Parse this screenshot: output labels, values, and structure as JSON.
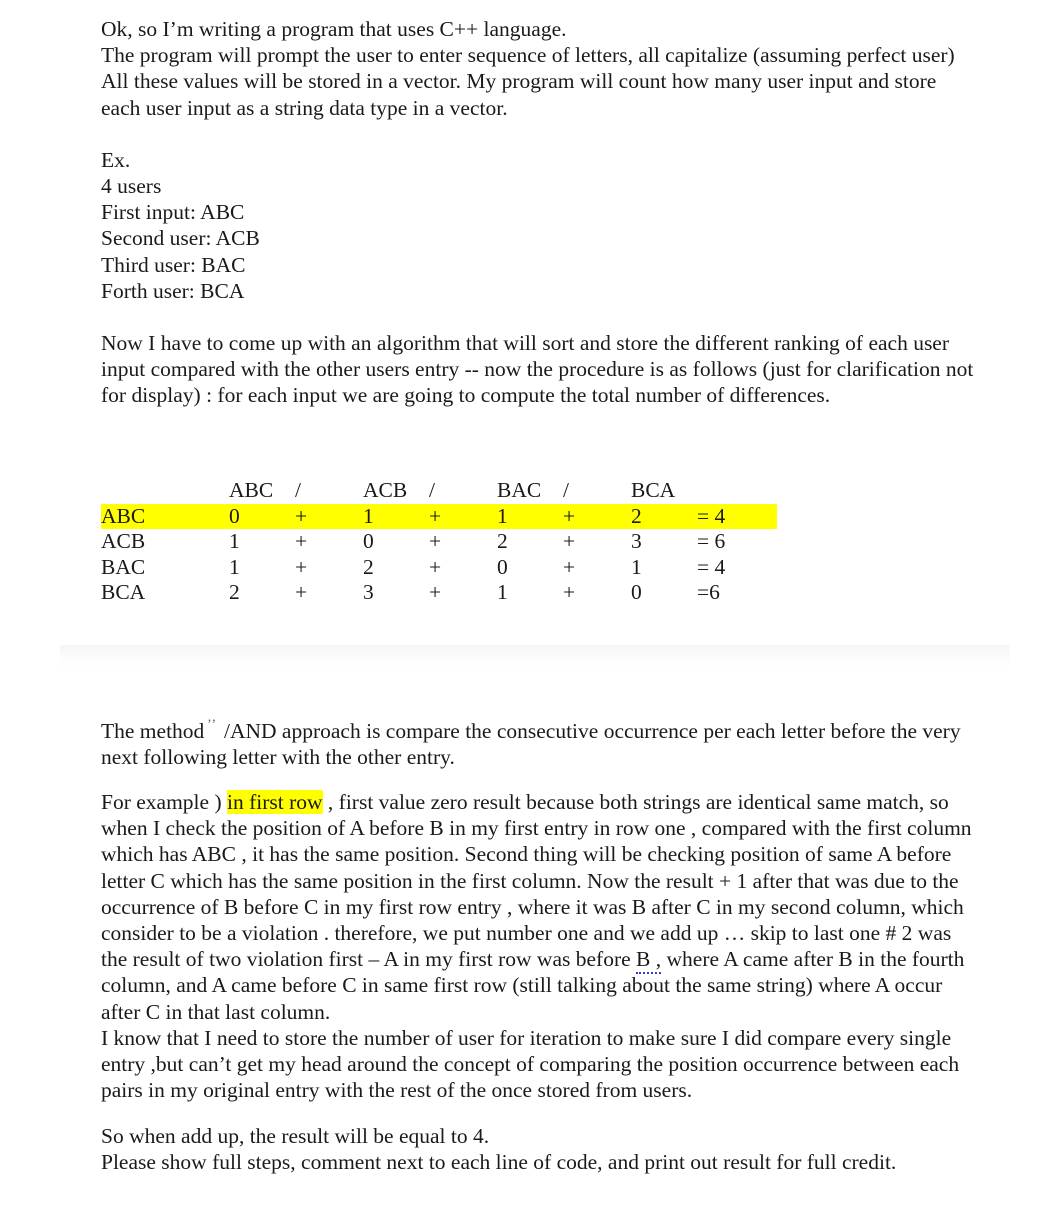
{
  "document": {
    "intro": {
      "line1": "Ok, so I’m writing a program that uses C++ language.",
      "line2": "The program will prompt the user to enter sequence of letters, all capitalize (assuming perfect user)",
      "line3": "All these values will be stored in a vector. My program will count how many user input and store each user input as a string data type in a vector."
    },
    "example": {
      "heading": "Ex.",
      "count": "4 users",
      "entries": [
        "First input: ABC",
        "Second user: ACB",
        "Third user: BAC",
        "Forth user: BCA"
      ]
    },
    "algorithm_paragraph": "Now I have to come up with an algorithm that will sort and store the different ranking of each user input compared with the other users entry -- now the procedure is as follows (just for clarification not for display) : for each input we are going to compute the total number of differences.",
    "method_paragraph": {
      "before_mark": "The method",
      "mark": "’’",
      "after_mark": "/AND approach is compare the consecutive occurrence per each letter before the very next following letter with the other entry."
    },
    "explanation_paragraph": {
      "lead": "For example ) ",
      "highlight": "in first row",
      "rest_a": " , first value zero result because both strings are identical same match, so when I check the position of A before B in my first entry in row one , compared with the first column which has ABC , it has the same position. Second thing will be checking position of same A before letter C which has the same position in the first column. Now the result + 1 after that was due to the occurrence of B before C in my first row entry , where it was B after C in my second column, which consider to be a violation . therefore, we put number one and we add up … skip to last one # 2 was the result of two violation first – A in my first row was before ",
      "grammar_flag": "B ,",
      "rest_b": " where A came after B in the fourth column, and A came before C in same first row (still talking about the same string) where A occur after C in that last column.",
      "next_line": "I know that I need to store the number of user for iteration to make sure I did compare every single entry ,but can’t get my head around the concept of comparing the position occurrence between each pairs in my original entry with the rest of the once stored from users."
    },
    "closing": {
      "line1": "So when add up, the result will be equal to 4.",
      "line2": "Please show full steps, comment next to each line of code, and print out result for full credit."
    }
  },
  "matrix": {
    "column_headers": [
      "",
      "ABC",
      "/",
      "ACB",
      "/",
      "BAC",
      "/",
      "BCA",
      ""
    ],
    "rows": [
      {
        "label": "ABC",
        "values": [
          "0",
          "+",
          "1",
          "+",
          "1",
          "+",
          "2"
        ],
        "total": "= 4",
        "highlighted": true
      },
      {
        "label": "ACB",
        "values": [
          "1",
          "+",
          "0",
          "+",
          "2",
          "+",
          "3"
        ],
        "total": "= 6",
        "highlighted": false
      },
      {
        "label": "BAC",
        "values": [
          "1",
          "+",
          "2",
          "+",
          "0",
          "+",
          "1"
        ],
        "total": "= 4",
        "highlighted": false
      },
      {
        "label": "BCA",
        "values": [
          "2",
          "+",
          "3",
          "+",
          "1",
          "+",
          "0"
        ],
        "total": "=6",
        "highlighted": false
      }
    ]
  },
  "colors": {
    "highlight": "#ffff00",
    "text": "#1a1a1a",
    "grammar_underline": "#3b3bcf",
    "page_background": "#ffffff"
  }
}
